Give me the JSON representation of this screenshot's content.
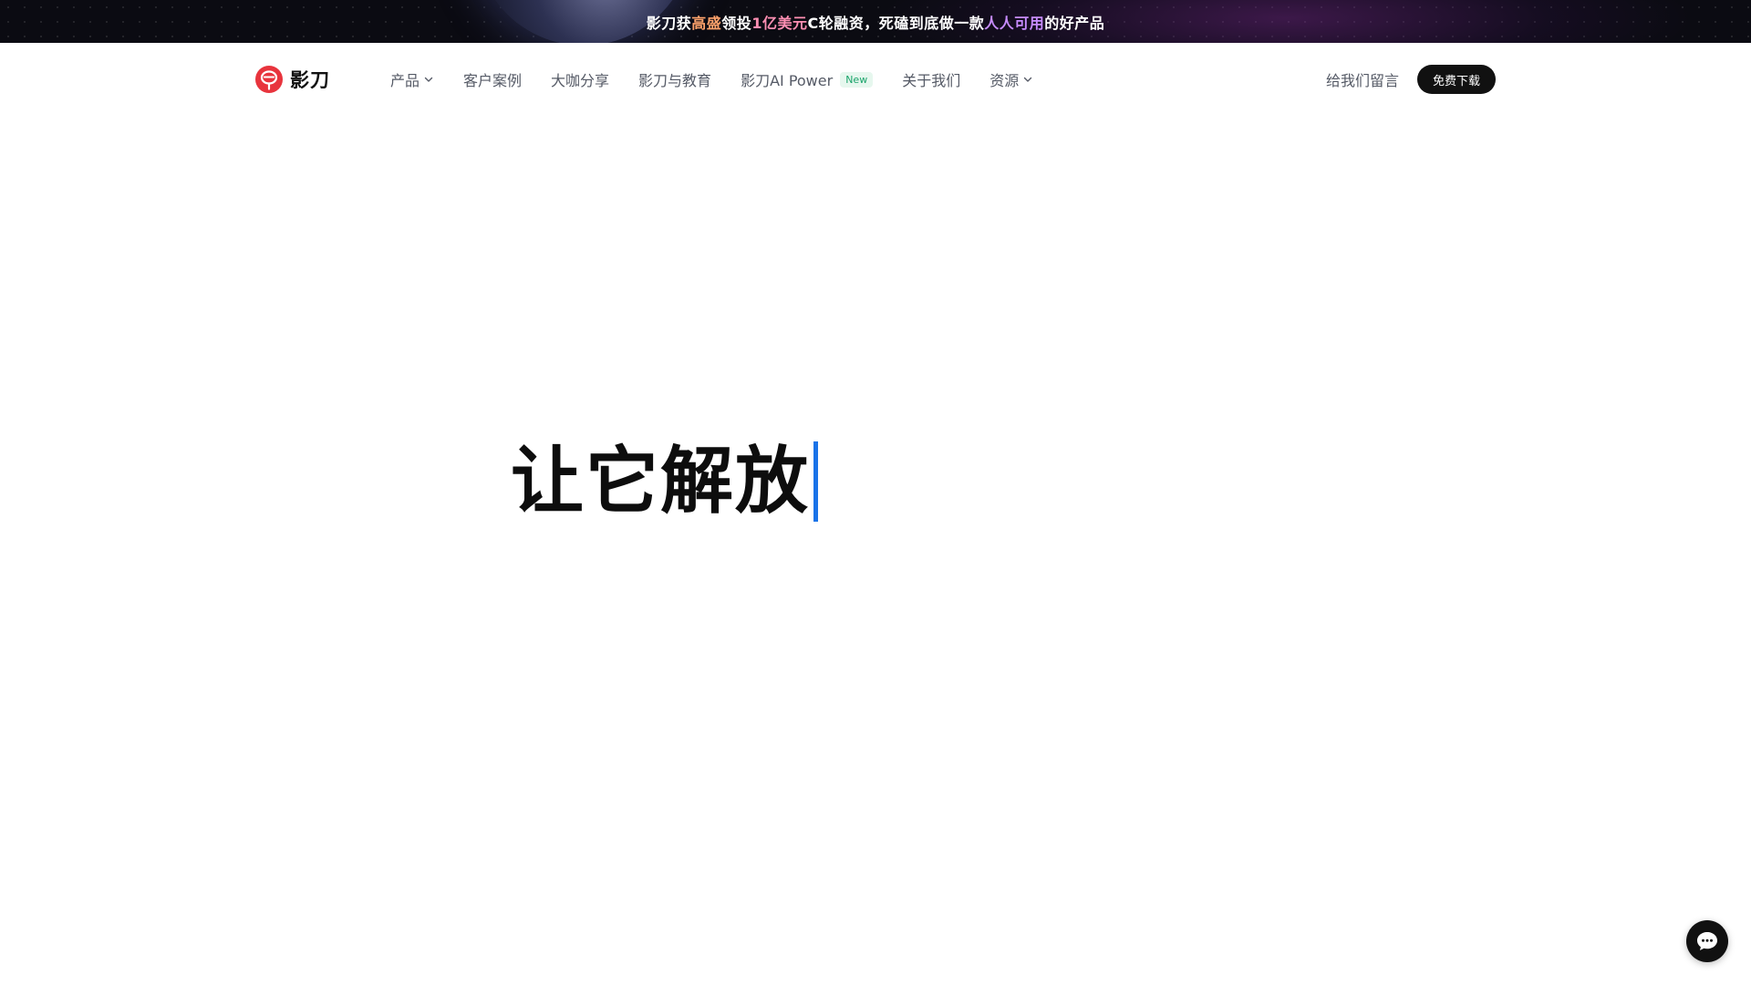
{
  "banner": {
    "segments": [
      {
        "text": "影刀获",
        "style": "plain"
      },
      {
        "text": "高盛",
        "style": "orange"
      },
      {
        "text": "领投",
        "style": "plain"
      },
      {
        "text": "1亿美元",
        "style": "pink"
      },
      {
        "text": "C轮融资，死磕到底做一款",
        "style": "plain"
      },
      {
        "text": "人人可用",
        "style": "purple"
      },
      {
        "text": "的好产品",
        "style": "plain"
      }
    ]
  },
  "logo": {
    "text": "影刀"
  },
  "nav": {
    "items": [
      {
        "label": "产品",
        "dropdown": true
      },
      {
        "label": "客户案例"
      },
      {
        "label": "大咖分享"
      },
      {
        "label": "影刀与教育"
      },
      {
        "label": "影刀AI Power",
        "badge": "New"
      },
      {
        "label": "关于我们"
      },
      {
        "label": "资源",
        "dropdown": true
      }
    ],
    "contact_label": "给我们留言",
    "download_label": "免费下载"
  },
  "hero": {
    "title": "让它解放"
  },
  "colors": {
    "accent_caret": "#1a73e8",
    "logo_red": "#e8343d",
    "new_badge_green": "#1aa36a"
  }
}
